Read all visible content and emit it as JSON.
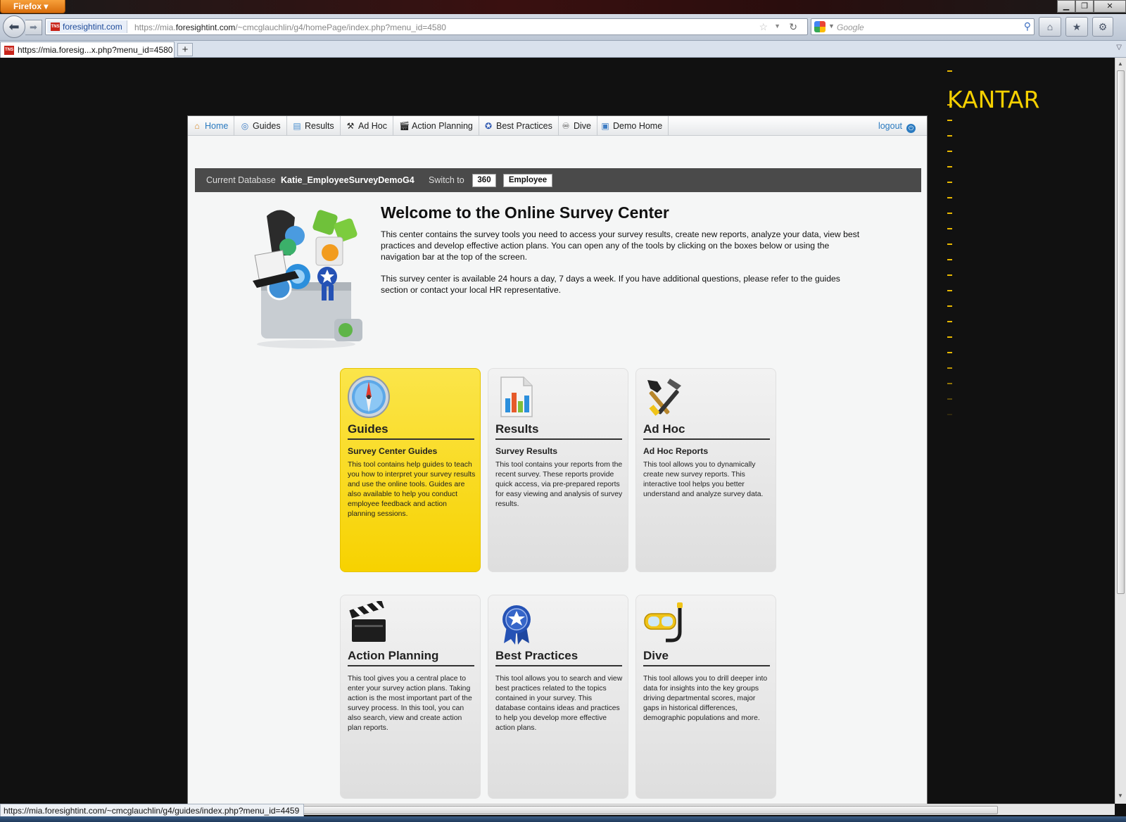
{
  "browser": {
    "app_button": "Firefox",
    "site_identity": "foresightint.com",
    "url_prefix": "https://mia.",
    "url_host": "foresightint.com",
    "url_path": "/~cmcglauchlin/g4/homePage/index.php?menu_id=4580",
    "search_placeholder": "Google",
    "tab_title": "https://mia.foresig...x.php?menu_id=4580",
    "status_url": "https://mia.foresightint.com/~cmcglauchlin/g4/guides/index.php?menu_id=4459"
  },
  "brand": {
    "logo_text": "KANTAR",
    "accent": "#f5d000"
  },
  "nav": {
    "items": [
      {
        "label": "Home",
        "icon": "home-icon",
        "active": true
      },
      {
        "label": "Guides",
        "icon": "compass-icon"
      },
      {
        "label": "Results",
        "icon": "report-icon"
      },
      {
        "label": "Ad Hoc",
        "icon": "tools-icon"
      },
      {
        "label": "Action Planning",
        "icon": "clapperboard-icon"
      },
      {
        "label": "Best Practices",
        "icon": "ribbon-icon"
      },
      {
        "label": "Dive",
        "icon": "snorkel-icon"
      },
      {
        "label": "Demo Home",
        "icon": "monitor-icon"
      }
    ],
    "logout": "logout"
  },
  "database": {
    "label": "Current Database",
    "name": "Katie_EmployeeSurveyDemoG4",
    "switch_label": "Switch to",
    "options": [
      "360",
      "Employee"
    ]
  },
  "welcome": {
    "title": "Welcome to the Online Survey Center",
    "para1": "This center contains the survey tools you need to access your survey results, create new reports, analyze your data, view best practices and develop effective action plans. You can open any of the tools by clicking on the boxes below or using the navigation bar at the top of the screen.",
    "para2": "This survey center is available 24 hours a day, 7 days a week. If you have additional questions, please refer to the guides section or contact your local HR representative."
  },
  "tiles": [
    {
      "title": "Guides",
      "subtitle": "Survey Center Guides",
      "icon": "compass-icon",
      "desc": "This tool contains help guides to teach you how to interpret your survey results and use the online tools. Guides are also available to help you conduct employee feedback and action planning sessions."
    },
    {
      "title": "Results",
      "subtitle": "Survey Results",
      "icon": "bar-chart-icon",
      "desc": "This tool contains your reports from the recent survey. These reports provide quick access, via pre-prepared reports for easy viewing and analysis of survey results."
    },
    {
      "title": "Ad Hoc",
      "subtitle": "Ad Hoc Reports",
      "icon": "tools-icon",
      "desc": "This tool allows you to dynamically create new survey reports. This interactive tool helps you better understand and analyze survey data."
    },
    {
      "title": "Action Planning",
      "subtitle": "",
      "icon": "clapperboard-icon",
      "desc": "This tool gives you a central place to enter your survey action plans. Taking action is the most important part of the survey process. In this tool, you can also search, view and create action plan reports."
    },
    {
      "title": "Best Practices",
      "subtitle": "",
      "icon": "ribbon-icon",
      "desc": "This tool allows you to search and view best practices related to the topics contained in your survey. This database contains ideas and practices to help you develop more effective action plans."
    },
    {
      "title": "Dive",
      "subtitle": "",
      "icon": "snorkel-icon",
      "desc": "This tool allows you to drill deeper into data for insights into the key groups driving departmental scores, major gaps in historical differences, demographic populations and more."
    }
  ]
}
